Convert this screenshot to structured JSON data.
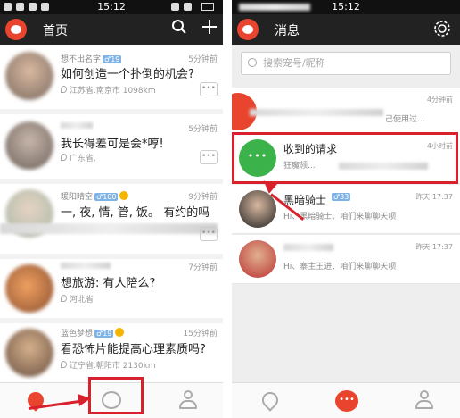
{
  "left": {
    "status_time": "15:12",
    "title": "首页",
    "posts": [
      {
        "name": "想不出名字",
        "badge": "♂19",
        "text": "如何创造一个扑倒的机会?",
        "location": "江苏省.南京市 1098km",
        "time": "5分钟前",
        "more": "•••"
      },
      {
        "name": "",
        "badge": "",
        "text": "我长得差可是会*哼!",
        "location": "广东省.",
        "time": "5分钟前",
        "more": "•••"
      },
      {
        "name": "暖阳晴空",
        "badge": "♂100",
        "text": "一, 夜, 情, 管, 饭。 有约的吗",
        "location": "",
        "time": "9分钟前",
        "more": "•••"
      },
      {
        "name": "",
        "badge": "",
        "text": "想旅游:   有人陪么?",
        "location": "河北省",
        "time": "7分钟前",
        "more": ""
      },
      {
        "name": "蓝色梦想",
        "badge": "♂19",
        "text": "看恐怖片能提高心理素质吗?",
        "location": "辽宁省.朝阳市 2130km",
        "time": "15分钟前",
        "more": ""
      }
    ]
  },
  "right": {
    "status_time": "15:12",
    "title": "消息",
    "search_placeholder": "搜索宠号/昵称",
    "messages": [
      {
        "name": "",
        "snippet": "己使用过...",
        "time": "4分钟前",
        "badge": ""
      },
      {
        "name": "收到的请求",
        "snippet": "狂魔领...",
        "time": "4小时前",
        "badge": ""
      },
      {
        "name": "黑暗骑士",
        "snippet": "Hi、黑暗骑士、咱们来聊聊天呗",
        "time": "昨天 17:37",
        "badge": "♂33"
      },
      {
        "name": "",
        "snippet": "Hi、寨主王进、咱们来聊聊天呗",
        "time": "昨天 17:37",
        "badge": ""
      }
    ]
  },
  "colors": {
    "accent_red": "#d8212c",
    "brand": "#e9452e",
    "green": "#3cb34a",
    "appbar": "#222222"
  }
}
